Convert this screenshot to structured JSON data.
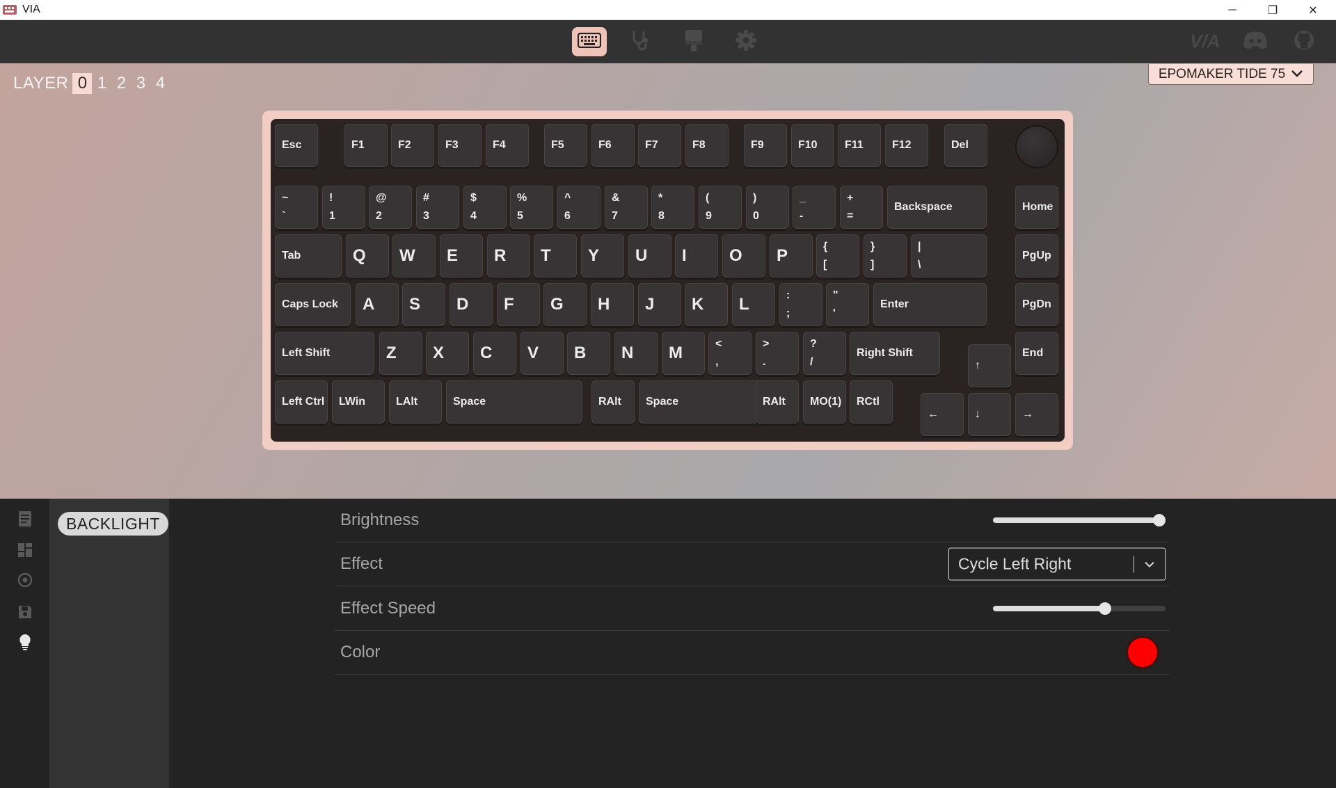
{
  "window": {
    "title": "VIA",
    "minimize": "─",
    "restore": "❐",
    "close": "✕"
  },
  "toolbar": {
    "tabs": [
      {
        "name": "configure",
        "icon": "keyboard-icon",
        "active": true
      },
      {
        "name": "key-tester",
        "icon": "stethoscope-icon",
        "active": false
      },
      {
        "name": "design",
        "icon": "paintbrush-icon",
        "active": false
      },
      {
        "name": "settings",
        "icon": "gear-icon",
        "active": false
      }
    ],
    "right": [
      {
        "name": "via-logo",
        "icon": "via-logo-icon"
      },
      {
        "name": "discord",
        "icon": "discord-icon"
      },
      {
        "name": "github",
        "icon": "github-icon"
      }
    ]
  },
  "layers": {
    "label": "LAYER",
    "items": [
      "0",
      "1",
      "2",
      "3",
      "4"
    ],
    "active": "0"
  },
  "keyboard_selector": {
    "value": "EPOMAKER TIDE 75"
  },
  "keys": {
    "esc": "Esc",
    "f1": "F1",
    "f2": "F2",
    "f3": "F3",
    "f4": "F4",
    "f5": "F5",
    "f6": "F6",
    "f7": "F7",
    "f8": "F8",
    "f9": "F9",
    "f10": "F10",
    "f11": "F11",
    "f12": "F12",
    "del": "Del",
    "grave_top": "~",
    "grave_bot": "`",
    "n1_top": "!",
    "n1_bot": "1",
    "n2_top": "@",
    "n2_bot": "2",
    "n3_top": "#",
    "n3_bot": "3",
    "n4_top": "$",
    "n4_bot": "4",
    "n5_top": "%",
    "n5_bot": "5",
    "n6_top": "^",
    "n6_bot": "6",
    "n7_top": "&",
    "n7_bot": "7",
    "n8_top": "*",
    "n8_bot": "8",
    "n9_top": "(",
    "n9_bot": "9",
    "n0_top": ")",
    "n0_bot": "0",
    "minus_top": "_",
    "minus_bot": "-",
    "equal_top": "+",
    "equal_bot": "=",
    "backspace": "Backspace",
    "home": "Home",
    "tab": "Tab",
    "q": "Q",
    "w": "W",
    "e": "E",
    "r": "R",
    "t": "T",
    "y": "Y",
    "u": "U",
    "i": "I",
    "o": "O",
    "p": "P",
    "lbracket_top": "{",
    "lbracket_bot": "[",
    "rbracket_top": "}",
    "rbracket_bot": "]",
    "backslash_top": "|",
    "backslash_bot": "\\",
    "pgup": "PgUp",
    "caps": "Caps Lock",
    "a": "A",
    "s": "S",
    "d": "D",
    "f": "F",
    "g": "G",
    "h": "H",
    "j": "J",
    "k": "K",
    "l": "L",
    "semicolon_top": ":",
    "semicolon_bot": ";",
    "quote_top": "\"",
    "quote_bot": "'",
    "enter": "Enter",
    "pgdn": "PgDn",
    "lshift": "Left Shift",
    "z": "Z",
    "x": "X",
    "c": "C",
    "v": "V",
    "b": "B",
    "n": "N",
    "m": "M",
    "comma_top": "<",
    "comma_bot": ",",
    "period_top": ">",
    "period_bot": ".",
    "slash_top": "?",
    "slash_bot": "/",
    "rshift": "Right Shift",
    "up": "↑",
    "end": "End",
    "lctrl": "Left Ctrl",
    "lwin": "LWin",
    "lalt": "LAlt",
    "lspace": "Space",
    "ralt": "RAlt",
    "rspace": "Space",
    "ralt2": "RAlt",
    "mo": "MO(1)",
    "rctrl": "RCtl",
    "left": "←",
    "down": "↓",
    "right": "→"
  },
  "sidebar": {
    "items": [
      {
        "name": "keymap",
        "icon": "keymap-icon"
      },
      {
        "name": "layouts",
        "icon": "layouts-icon"
      },
      {
        "name": "macros",
        "icon": "macros-icon"
      },
      {
        "name": "save-load",
        "icon": "save-icon"
      },
      {
        "name": "lighting",
        "icon": "lightbulb-icon",
        "active": true
      }
    ]
  },
  "menu": {
    "active_label": "BACKLIGHT"
  },
  "settings": {
    "brightness": {
      "label": "Brightness",
      "value": 1.0
    },
    "effect": {
      "label": "Effect",
      "value": "Cycle Left Right"
    },
    "effect_speed": {
      "label": "Effect Speed",
      "value": 0.65
    },
    "color": {
      "label": "Color",
      "value": "#ff0000"
    }
  },
  "colors": {
    "accent": "#efc4b8",
    "case": "#f2cdc3",
    "plate": "#2b2322",
    "keycap": "#383435"
  }
}
